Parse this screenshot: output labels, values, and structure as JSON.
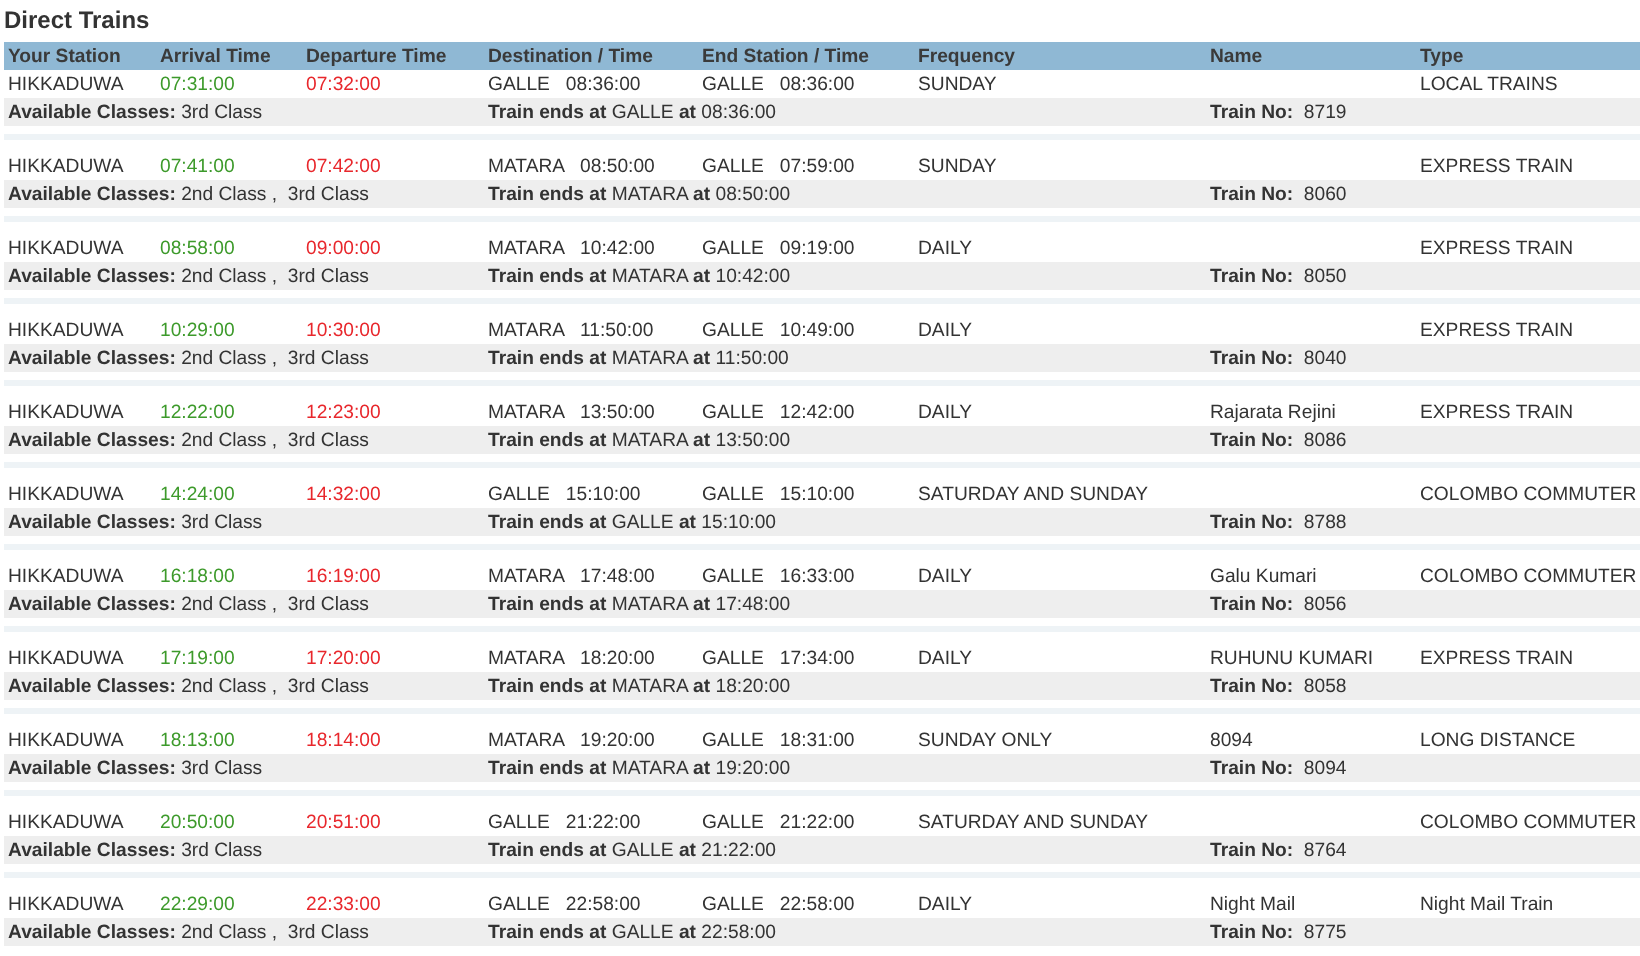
{
  "title": "Direct Trains",
  "columns": [
    "Your Station",
    "Arrival Time",
    "Departure Time",
    "Destination / Time",
    "End Station / Time",
    "Frequency",
    "Name",
    "Type"
  ],
  "trains": [
    {
      "station": "HIKKADUWA",
      "arrival": "07:31:00",
      "departure": "07:32:00",
      "destination": "GALLE   08:36:00",
      "end_station": "GALLE   08:36:00",
      "frequency": "SUNDAY",
      "type": "LOCAL TRAINS",
      "classes": "**Available Classes:** 3rd Class",
      "note": "**Train ends at** GALLE **at** 08:36:00",
      "train_no": "**Train No:**  8719"
    },
    {
      "station": "HIKKADUWA",
      "arrival": "07:41:00",
      "departure": "07:42:00",
      "destination": "MATARA   08:50:00",
      "end_station": "GALLE   07:59:00",
      "frequency": "SUNDAY",
      "type": "EXPRESS TRAIN",
      "classes": "**Available Classes:** 2nd Class ,  3rd Class",
      "note": "**Train ends at** MATARA **at** 08:50:00",
      "train_no": "**Train No:**  8060"
    },
    {
      "station": "HIKKADUWA",
      "arrival": "08:58:00",
      "departure": "09:00:00",
      "destination": "MATARA   10:42:00",
      "end_station": "GALLE   09:19:00",
      "frequency": "DAILY",
      "type": "EXPRESS TRAIN",
      "classes": "**Available Classes:** 2nd Class ,  3rd Class",
      "note": "**Train ends at** MATARA **at** 10:42:00",
      "train_no": "**Train No:**  8050"
    },
    {
      "station": "HIKKADUWA",
      "arrival": "10:29:00",
      "departure": "10:30:00",
      "destination": "MATARA   11:50:00",
      "end_station": "GALLE   10:49:00",
      "frequency": "DAILY",
      "type": "EXPRESS TRAIN",
      "classes": "**Available Classes:** 2nd Class ,  3rd Class",
      "note": "**Train ends at** MATARA **at** 11:50:00",
      "train_no": "**Train No:**  8040"
    },
    {
      "station": "HIKKADUWA",
      "arrival": "12:22:00",
      "departure": "12:23:00",
      "destination": "MATARA   13:50:00",
      "end_station": "GALLE   12:42:00",
      "frequency": "DAILY",
      "name": "Rajarata Rejini",
      "type": "EXPRESS TRAIN",
      "classes": "**Available Classes:** 2nd Class ,  3rd Class",
      "note": "**Train ends at** MATARA **at** 13:50:00",
      "train_no": "**Train No:**  8086"
    },
    {
      "station": "HIKKADUWA",
      "arrival": "14:24:00",
      "departure": "14:32:00",
      "destination": "GALLE   15:10:00",
      "end_station": "GALLE   15:10:00",
      "frequency": "SATURDAY AND SUNDAY",
      "type": "COLOMBO COMMUTER",
      "classes": "**Available Classes:** 3rd Class",
      "note": "**Train ends at** GALLE **at** 15:10:00",
      "train_no": "**Train No:**  8788"
    },
    {
      "station": "HIKKADUWA",
      "arrival": "16:18:00",
      "departure": "16:19:00",
      "destination": "MATARA   17:48:00",
      "end_station": "GALLE   16:33:00",
      "frequency": "DAILY",
      "name": "Galu Kumari",
      "type": "COLOMBO COMMUTER",
      "classes": "**Available Classes:** 2nd Class ,  3rd Class",
      "note": "**Train ends at** MATARA **at** 17:48:00",
      "train_no": "**Train No:**  8056"
    },
    {
      "station": "HIKKADUWA",
      "arrival": "17:19:00",
      "departure": "17:20:00",
      "destination": "MATARA   18:20:00",
      "end_station": "GALLE   17:34:00",
      "frequency": "DAILY",
      "name": "RUHUNU KUMARI",
      "type": "EXPRESS TRAIN",
      "classes": "**Available Classes:** 2nd Class ,  3rd Class",
      "note": "**Train ends at** MATARA **at** 18:20:00",
      "train_no": "**Train No:**  8058"
    },
    {
      "station": "HIKKADUWA",
      "arrival": "18:13:00",
      "departure": "18:14:00",
      "destination": "MATARA   19:20:00",
      "end_station": "GALLE   18:31:00",
      "frequency": "SUNDAY ONLY",
      "name": "8094",
      "type": "LONG DISTANCE",
      "classes": "**Available Classes:** 3rd Class",
      "note": "**Train ends at** MATARA **at** 19:20:00",
      "train_no": "**Train No:**  8094"
    },
    {
      "station": "HIKKADUWA",
      "arrival": "20:50:00",
      "departure": "20:51:00",
      "destination": "GALLE   21:22:00",
      "end_station": "GALLE   21:22:00",
      "frequency": "SATURDAY AND SUNDAY",
      "type": "COLOMBO COMMUTER",
      "classes": "**Available Classes:** 3rd Class",
      "note": "**Train ends at** GALLE **at** 21:22:00",
      "train_no": "**Train No:**  8764"
    },
    {
      "station": "HIKKADUWA",
      "arrival": "22:29:00",
      "departure": "22:33:00",
      "destination": "GALLE   22:58:00",
      "end_station": "GALLE   22:58:00",
      "frequency": "DAILY",
      "name": "Night Mail",
      "type": "Night Mail Train",
      "classes": "**Available Classes:** 2nd Class ,  3rd Class",
      "note": "**Train ends at** GALLE **at** 22:58:00",
      "train_no": "**Train No:**  8775"
    }
  ]
}
